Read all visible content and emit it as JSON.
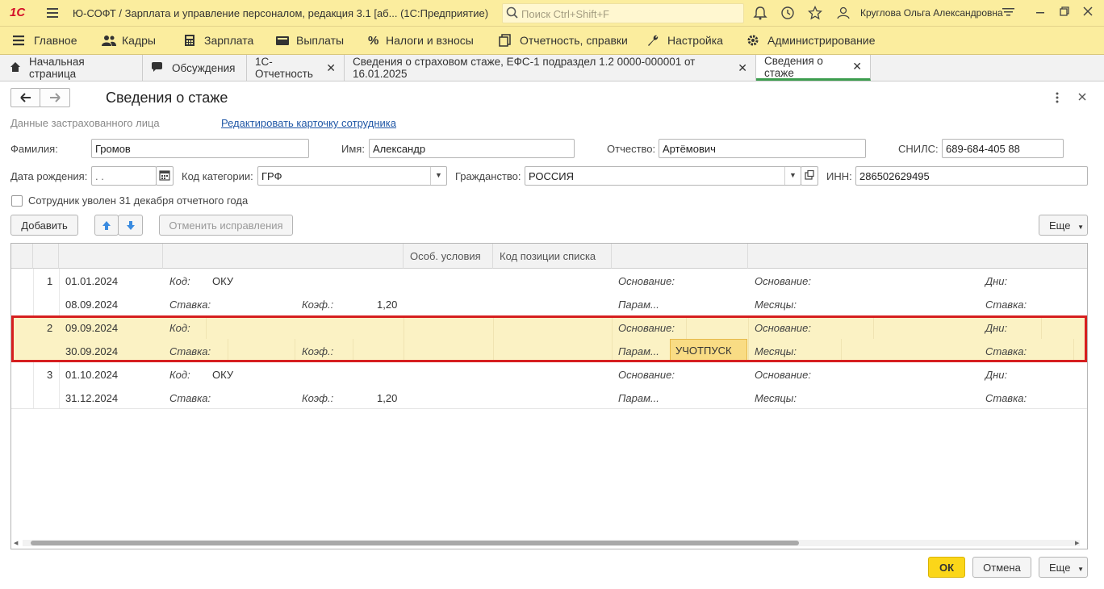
{
  "app": {
    "logo": "1С",
    "title": "Ю-СОФТ / Зарплата и управление персоналом, редакция 3.1 [аб...  (1С:Предприятие)",
    "search_placeholder": "Поиск Ctrl+Shift+F",
    "user": "Круглова Ольга Александровна"
  },
  "menu": [
    {
      "label": "Главное",
      "icon": "menu-icon"
    },
    {
      "label": "Кадры",
      "icon": "people-icon"
    },
    {
      "label": "Зарплата",
      "icon": "calculator-icon"
    },
    {
      "label": "Выплаты",
      "icon": "wallet-icon"
    },
    {
      "label": "Налоги и взносы",
      "icon": "percent-icon"
    },
    {
      "label": "Отчетность, справки",
      "icon": "reports-icon"
    },
    {
      "label": "Настройка",
      "icon": "wrench-icon"
    },
    {
      "label": "Администрирование",
      "icon": "gear-icon"
    }
  ],
  "tabs": [
    {
      "label": "Начальная страница",
      "icon": "home-icon",
      "closable": false
    },
    {
      "label": "Обсуждения",
      "icon": "chat-icon",
      "closable": false
    },
    {
      "label": "1С-Отчетность",
      "closable": true
    },
    {
      "label": "Сведения о страховом стаже, ЕФС-1 подраздел 1.2 0000-000001 от 16.01.2025",
      "closable": true
    },
    {
      "label": "Сведения о стаже",
      "closable": true,
      "active": true
    }
  ],
  "form": {
    "title": "Сведения о стаже",
    "section_label": "Данные застрахованного лица",
    "edit_link": "Редактировать карточку сотрудника",
    "surname_label": "Фамилия:",
    "surname": "Громов",
    "name_label": "Имя:",
    "name": "Александр",
    "patronymic_label": "Отчество:",
    "patronymic": "Артёмович",
    "snils_label": "СНИЛС:",
    "snils": "689-684-405 88",
    "birth_label": "Дата рождения:",
    "birth": " .  .",
    "category_label": "Код категории:",
    "category": "ГРФ",
    "citizenship_label": "Гражданство:",
    "citizenship": "РОССИЯ",
    "inn_label": "ИНН:",
    "inn": "286502629495",
    "dismissed_label": "Сотрудник уволен 31 декабря отчетного года",
    "add_button": "Добавить",
    "cancel_fix_button": "Отменить исправления",
    "more_button": "Еще"
  },
  "grid": {
    "headers": {
      "special": "Особ. условия",
      "list_code": "Код позиции списка"
    },
    "labels": {
      "code": "Код:",
      "rate": "Ставка:",
      "coef": "Коэф.:",
      "basis": "Основание:",
      "params": "Парам...",
      "months": "Месяцы:",
      "days": "Дни:"
    },
    "rows": [
      {
        "num": "1",
        "from": "01.01.2024",
        "to": "08.09.2024",
        "code": "ОКУ",
        "coef": "1,20",
        "param_value": ""
      },
      {
        "num": "2",
        "from": "09.09.2024",
        "to": "30.09.2024",
        "code": "",
        "coef": "",
        "param_value": "УЧОТПУСК"
      },
      {
        "num": "3",
        "from": "01.10.2024",
        "to": "31.12.2024",
        "code": "ОКУ",
        "coef": "1,20",
        "param_value": ""
      }
    ],
    "selected_row": 2
  },
  "footer": {
    "ok": "ОК",
    "cancel": "Отмена",
    "more": "Еще"
  }
}
